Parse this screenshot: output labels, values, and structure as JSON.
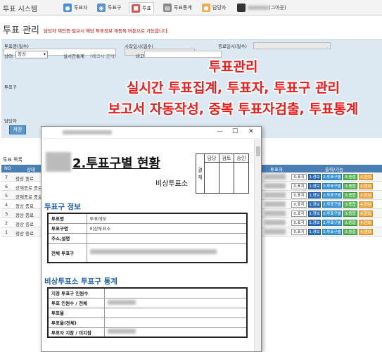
{
  "app": {
    "title": "투표 시스템",
    "nav_tabs": [
      {
        "label": "투표자",
        "icon": "user-icon",
        "color": "#4a90d9"
      },
      {
        "label": "투표구",
        "icon": "location-icon",
        "color": "#5b8fc9"
      },
      {
        "label": "투표",
        "icon": "ballot-icon",
        "color": "#d9534f"
      },
      {
        "label": "투표통계",
        "icon": "chart-icon",
        "color": "#888888"
      },
      {
        "label": "담당자",
        "icon": "person-icon",
        "color": "#f0ad4e"
      }
    ],
    "user_suffix": "(그아웃)"
  },
  "page": {
    "title": "투표 관리",
    "note": "담당자 재인증 필요시 해당 투표정보 재등록 버튼으로 가능합니다."
  },
  "form": {
    "vote_name_label": "투표명(필수)",
    "start_label": "시작일시(필수)",
    "end_label": "종료일시(필수)",
    "status_label": "상태",
    "status_value": "정상",
    "realtime_label": "실시간통계",
    "realtime_check": "(체크시 공개)",
    "note_label": "비고",
    "precinct_label": "투표구",
    "manager_label": "담당자",
    "save_label": "저장"
  },
  "promo": {
    "line1": "투표관리",
    "line2": "실시간 투표집계, 투표자, 투표구 관리",
    "line3": "보고서 자동작성, 중복 투표자검출, 투표통계"
  },
  "list": {
    "title": "투표 목록",
    "headers": {
      "no": "NO",
      "status": "상태",
      "voter": "투표자",
      "output": "출력/기능"
    },
    "rows": [
      {
        "no": "7",
        "status": "정상 종료"
      },
      {
        "no": "6",
        "status": "강제종료 종료"
      },
      {
        "no": "5",
        "status": "강제종료 종료"
      },
      {
        "no": "4",
        "status": "정상 종료"
      },
      {
        "no": "3",
        "status": "정상 종료"
      },
      {
        "no": "2",
        "status": "정상 종료"
      },
      {
        "no": "1",
        "status": "정상 종료"
      }
    ],
    "buttons": {
      "voter": "0.표지",
      "report": "1.경보",
      "precinct": "2.투표구별",
      "all": "3.종합",
      "stats": "4.연보"
    }
  },
  "popup": {
    "main_title": "2.투표구별 현황",
    "sub_title": "비상투표소",
    "approval": {
      "side": "결재",
      "cols": [
        "담당",
        "검토",
        "승인"
      ]
    },
    "section1_title": "투표구 정보",
    "section1_rows": [
      {
        "label": "투표명",
        "value": "투표데모"
      },
      {
        "label": "투표구명",
        "value": "비상투표소"
      },
      {
        "label": "주소,설명",
        "value": ""
      },
      {
        "label": "전체 투표구",
        "value": ""
      }
    ],
    "section2_title": "비상투표소 투표구 통계",
    "section2_rows": [
      {
        "label": "지정 투표구 인원수",
        "value": ""
      },
      {
        "label": "투표 인원수 / 전체",
        "value": ""
      },
      {
        "label": "투표율",
        "value": ""
      },
      {
        "label": "투표율(전체)",
        "value": ""
      },
      {
        "label": "투표자 지참 / 미지참",
        "value": ""
      }
    ]
  }
}
